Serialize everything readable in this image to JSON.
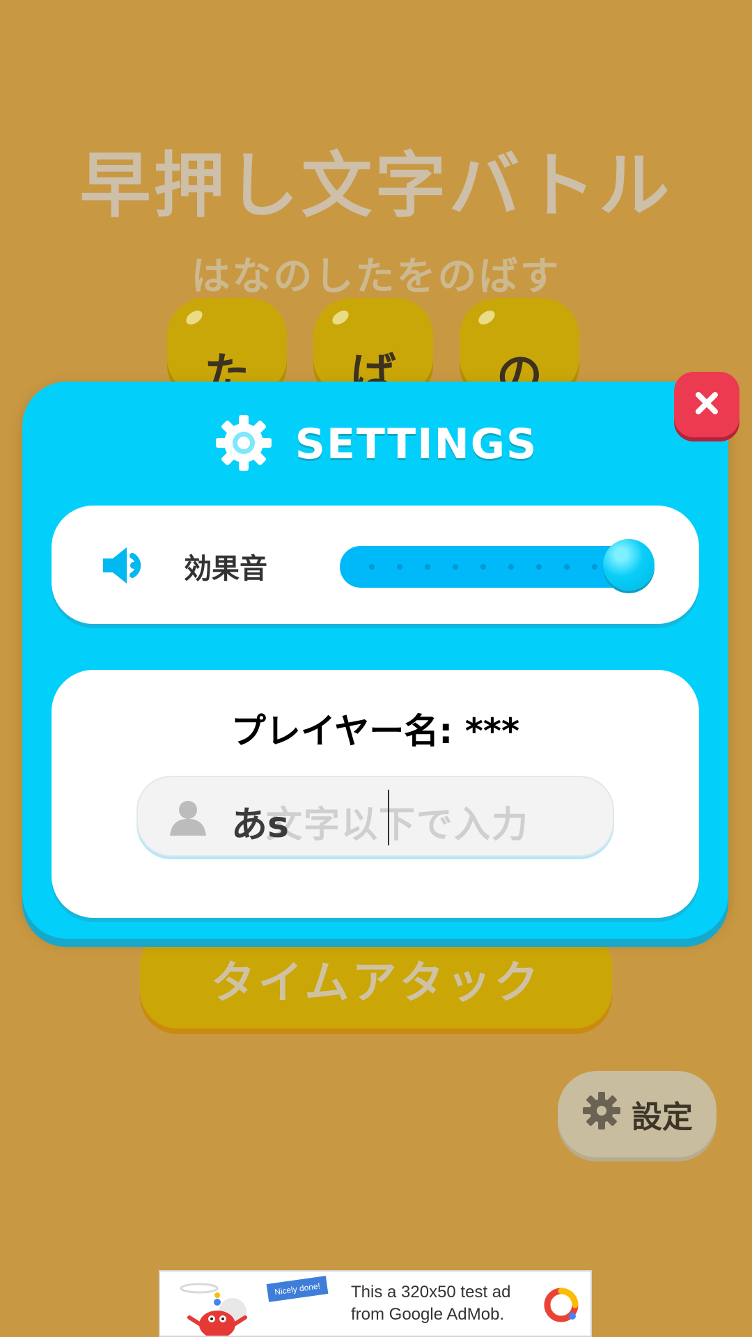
{
  "background": {
    "title": "早押し文字バトル",
    "subtitle": "はなのしたをのばす",
    "tiles": [
      "た",
      "ば",
      "の"
    ],
    "time_attack_label": "タイムアタック",
    "settings_button_label": "設定"
  },
  "modal": {
    "title": "SETTINGS",
    "sound": {
      "label": "効果音",
      "level": 1.0
    },
    "player": {
      "label": "プレイヤー名: ***",
      "input_value": "あs",
      "input_placeholder": "文字以下で入力"
    }
  },
  "ad": {
    "badge": "Nicely done!",
    "line1": "This a 320x50 test ad",
    "line2": "from Google AdMob."
  },
  "colors": {
    "background": "#c99842",
    "modal": "#02d0fb",
    "close": "#ec3a50",
    "tile": "#caa709"
  }
}
